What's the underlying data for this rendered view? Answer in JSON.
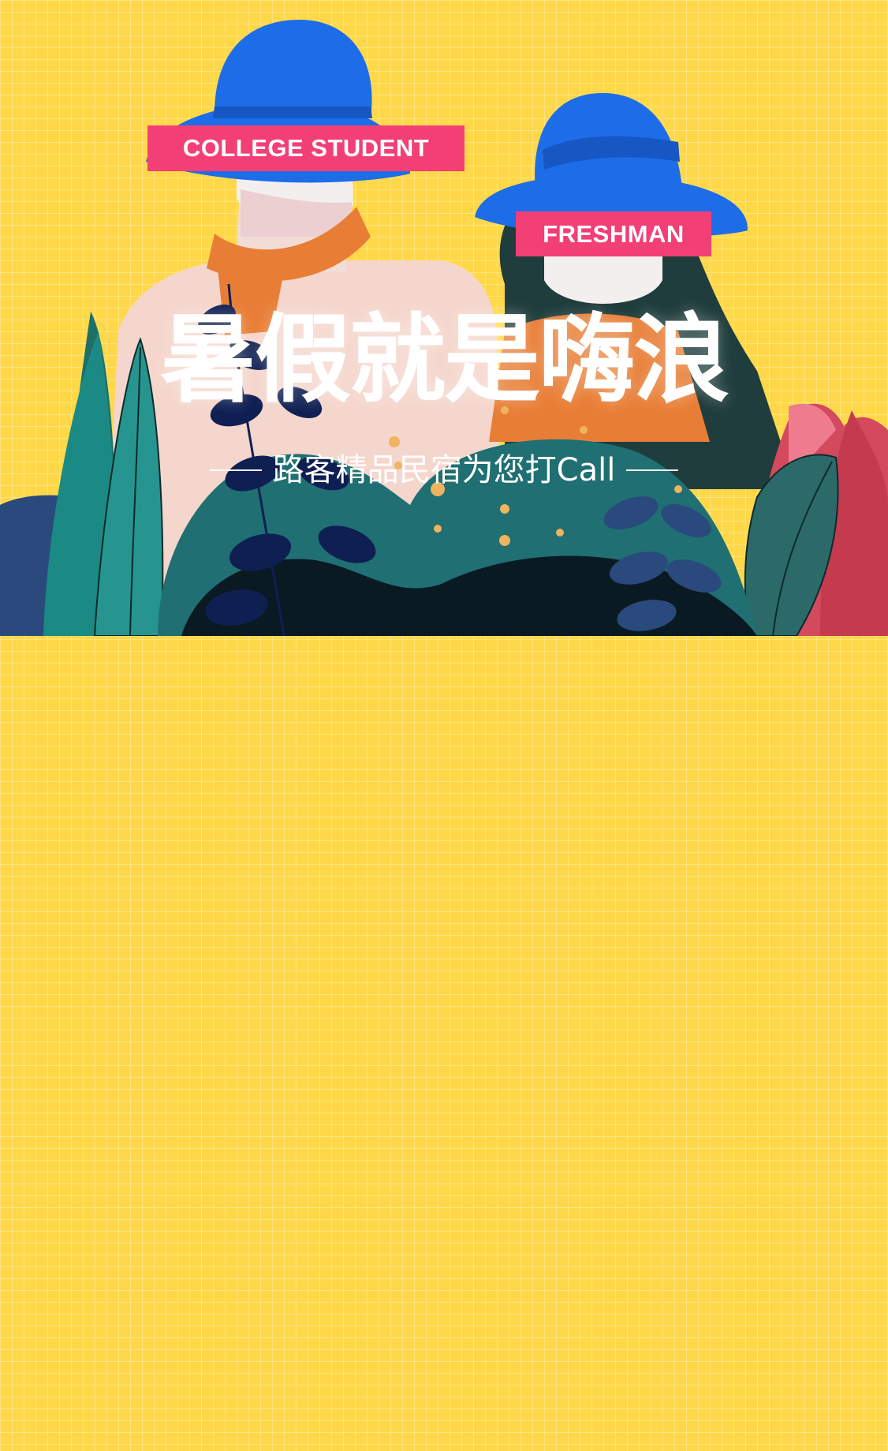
{
  "tags": {
    "college": "COLLEGE STUDENT",
    "freshman": "FRESHMAN"
  },
  "headline": "暑假就是嗨浪",
  "subline": "路客精品民宿为您打Call",
  "colors": {
    "background": "#ffd84a",
    "tag": "#f23f75",
    "hat": "#1e6de8",
    "scarf": "#e87e36",
    "foliage_teal": "#1c8a84",
    "foliage_navy": "#0f1f52",
    "leaf_red": "#d3495e"
  }
}
